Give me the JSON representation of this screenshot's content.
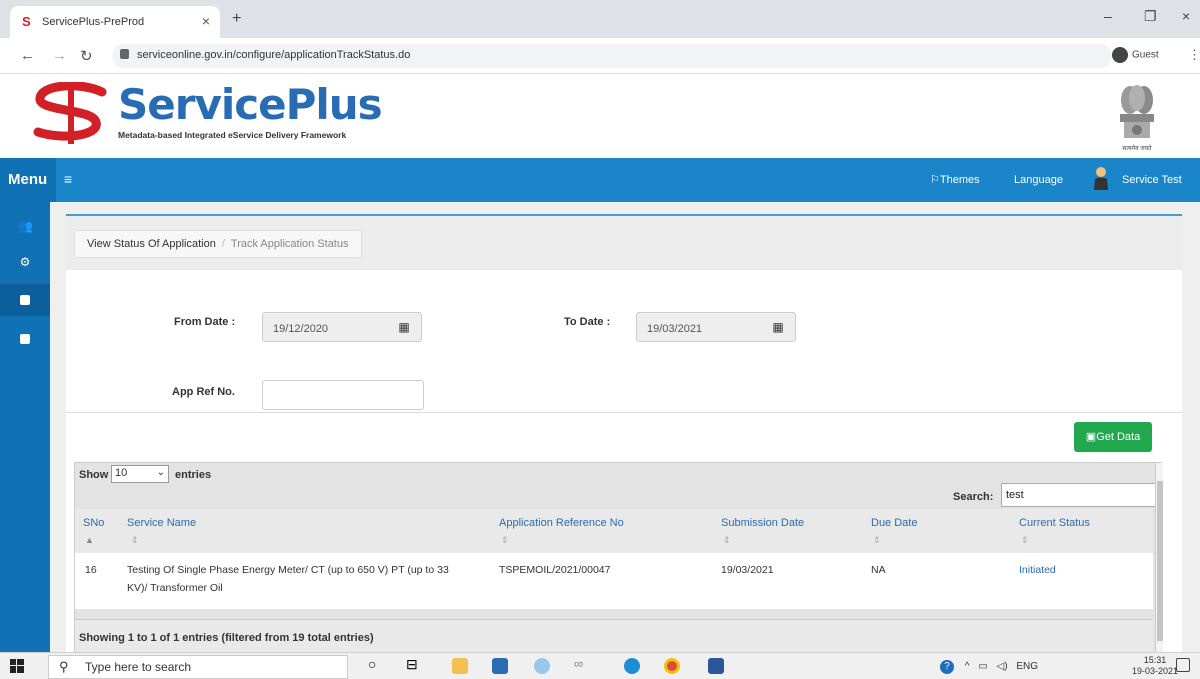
{
  "browser": {
    "tab_title": "ServicePlus-PreProd",
    "tab_close": "×",
    "new_tab": "+",
    "url": "serviceonline.gov.in/configure/applicationTrackStatus.do",
    "profile_label": "Guest"
  },
  "header": {
    "brand": "ServicePlus",
    "tagline": "Metadata-based Integrated eService Delivery Framework",
    "emblem_caption": "सत्यमेव जयते"
  },
  "topnav": {
    "menu_label": "Menu",
    "themes_label": "Themes",
    "language_label": "Language",
    "user_name": "Service Test"
  },
  "breadcrumb": {
    "parent": "View Status Of Application",
    "current": "Track Application Status"
  },
  "form": {
    "from_date_label": "From Date :",
    "from_date_value": "19/12/2020",
    "to_date_label": "To Date :",
    "to_date_value": "19/03/2021",
    "app_ref_label": "App Ref No.",
    "app_ref_value": "",
    "get_data_label": "Get Data"
  },
  "table": {
    "show_label": "Show",
    "page_length": "10",
    "entries_label": "entries",
    "search_label": "Search:",
    "search_value": "test",
    "columns": [
      "SNo",
      "Service Name",
      "Application Reference No",
      "Submission Date",
      "Due Date",
      "Current Status"
    ],
    "rows": [
      {
        "sno": "16",
        "service_name_line1": "Testing Of Single Phase Energy Meter/ CT (up to 650 V) PT (up to 33",
        "service_name_line2": "KV)/ Transformer Oil",
        "app_ref": "TSPEMOIL/2021/00047",
        "submission_date": "19/03/2021",
        "due_date": "NA",
        "status": "Initiated"
      }
    ],
    "info": "Showing 1 to 1 of 1 entries (filtered from 19 total entries)"
  },
  "taskbar": {
    "search_placeholder": "Type here to search",
    "language": "ENG",
    "time": "15:31",
    "date": "19-03-2021"
  },
  "colors": {
    "nav_blue": "#1b85c9",
    "sidebar_blue": "#1171b5",
    "brand_blue": "#2a6cb3",
    "brand_red": "#d31f26",
    "success_green": "#21a84f"
  }
}
